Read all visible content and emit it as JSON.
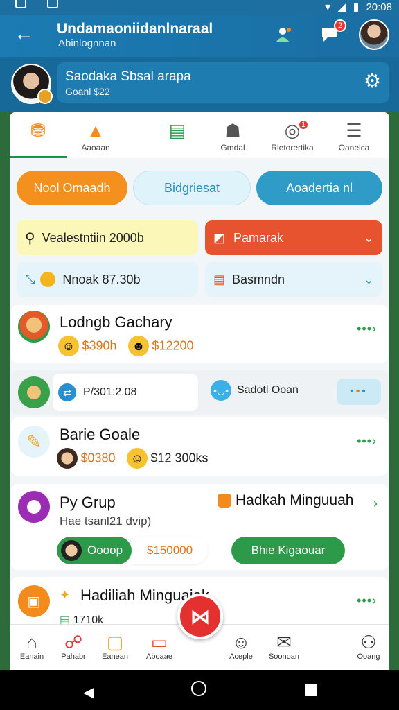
{
  "status_bar": {
    "time": "20:08"
  },
  "app_bar": {
    "title": "Undamaoniidanlnaraal",
    "subtitle": "Abinlognnan",
    "notification_badge": "2",
    "icons": [
      "back-arrow-icon",
      "people-icon",
      "chat-icon",
      "avatar"
    ]
  },
  "profile": {
    "name": "Saodaka Sbsal arapa",
    "subtitle": "Goanl $22"
  },
  "tabs": [
    {
      "label": "",
      "icon": "bag-icon"
    },
    {
      "label": "Aaoaan",
      "icon": "triangle-icon"
    },
    {
      "label": "",
      "icon": "list-icon"
    },
    {
      "label": "Gmdal",
      "icon": "people-icon"
    },
    {
      "label": "Rletorertika",
      "icon": "target-icon",
      "badge": "1"
    },
    {
      "label": "Oanelca",
      "icon": "menu-icon"
    }
  ],
  "pills": [
    "Nool Omaadh",
    "Bidgriesat",
    "Aoadertia nl"
  ],
  "filters": {
    "left_top": "Vealestntiin 2000b",
    "right_top": "Pamarak",
    "left_bottom": "Nnoak 87.30b",
    "right_bottom": "Basmndn"
  },
  "cards": {
    "card1": {
      "title": "Lodngb Gachary",
      "amount1": "$390h",
      "amount2": "$12200"
    },
    "card2": {
      "text1": "P/301:2.08",
      "text2": "Sadotl Ooan"
    },
    "card3": {
      "title": "Barie Goale",
      "amount1": "$0380",
      "amount2": "$12 300ks"
    },
    "card4": {
      "title": "Py Grup",
      "sub": "Hae tsanl21 dvip)",
      "right_title": "Hadkah Minguuah",
      "chip_label": "Oooop",
      "chip_amount": "$150000",
      "button": "Bhie Kigaouar"
    },
    "card5": {
      "title": "Hadiliah Minguaiak",
      "sub": "1710k"
    }
  },
  "bottom_nav": [
    "Eanain",
    "Pahabr",
    "Eanean",
    "Aboaae",
    "Aceple",
    "Soonoan",
    "Ooang"
  ],
  "colors": {
    "primary_blue": "#1b7bb2",
    "accent_green": "#2c9a49",
    "accent_orange": "#f28a1c",
    "accent_red": "#e8532f"
  }
}
